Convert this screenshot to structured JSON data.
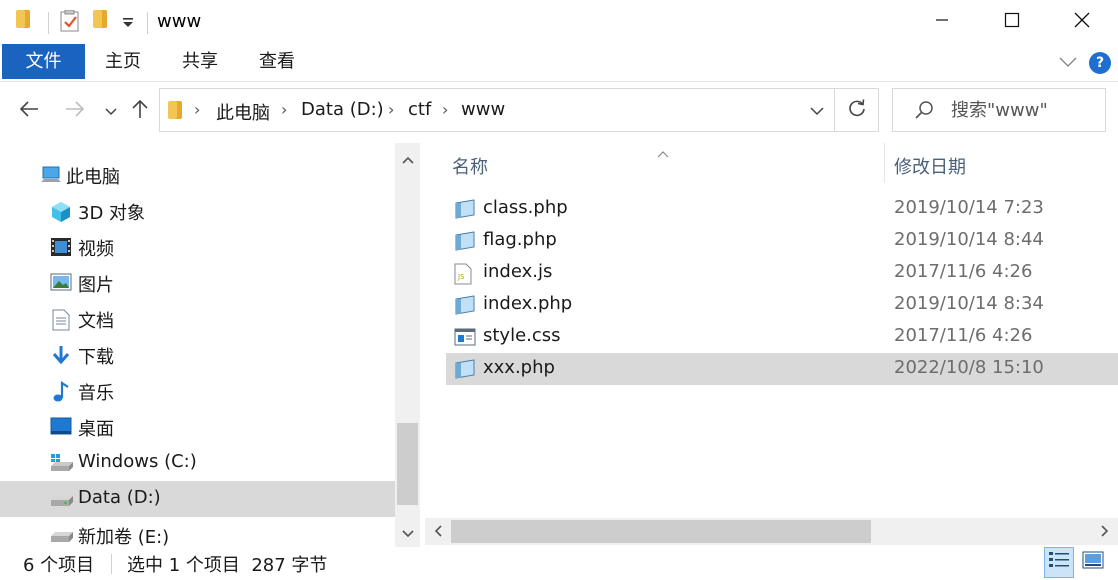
{
  "window": {
    "title": "www",
    "minimize_icon": "minimize-icon",
    "maximize_icon": "maximize-icon",
    "close_icon": "close-icon"
  },
  "ribbon": {
    "tabs": [
      {
        "label": "文件",
        "active": true
      },
      {
        "label": "主页",
        "active": false
      },
      {
        "label": "共享",
        "active": false
      },
      {
        "label": "查看",
        "active": false
      }
    ],
    "help": "?"
  },
  "address": {
    "crumbs": [
      "此电脑",
      "Data (D:)",
      "ctf",
      "www"
    ]
  },
  "search": {
    "placeholder": "搜索\"www\""
  },
  "navpane": {
    "items": [
      {
        "label": "此电脑",
        "icon": "this-pc-icon"
      },
      {
        "label": "3D 对象",
        "icon": "3d-objects-icon"
      },
      {
        "label": "视频",
        "icon": "videos-icon"
      },
      {
        "label": "图片",
        "icon": "pictures-icon"
      },
      {
        "label": "文档",
        "icon": "documents-icon"
      },
      {
        "label": "下载",
        "icon": "downloads-icon"
      },
      {
        "label": "音乐",
        "icon": "music-icon"
      },
      {
        "label": "桌面",
        "icon": "desktop-icon"
      },
      {
        "label": "Windows (C:)",
        "icon": "windows-drive-icon"
      },
      {
        "label": "Data (D:)",
        "icon": "drive-icon",
        "selected": true
      },
      {
        "label": "新加卷 (E:)",
        "icon": "drive-icon"
      }
    ]
  },
  "files": {
    "headers": {
      "name": "名称",
      "date": "修改日期"
    },
    "rows": [
      {
        "name": "class.php",
        "date": "2019/10/14 7:23",
        "type": "php"
      },
      {
        "name": "flag.php",
        "date": "2019/10/14 8:44",
        "type": "php"
      },
      {
        "name": "index.js",
        "date": "2017/11/6 4:26",
        "type": "js"
      },
      {
        "name": "index.php",
        "date": "2019/10/14 8:34",
        "type": "php"
      },
      {
        "name": "style.css",
        "date": "2017/11/6 4:26",
        "type": "css"
      },
      {
        "name": "xxx.php",
        "date": "2022/10/8 15:10",
        "type": "php",
        "selected": true
      }
    ]
  },
  "status": {
    "count": "6 个项目",
    "selection": "选中 1 个项目  287 字节"
  },
  "colors": {
    "accent": "#1a63be",
    "selection": "#d9d9d9",
    "header_text": "#4c607a",
    "date_text": "#6d6d6d"
  }
}
